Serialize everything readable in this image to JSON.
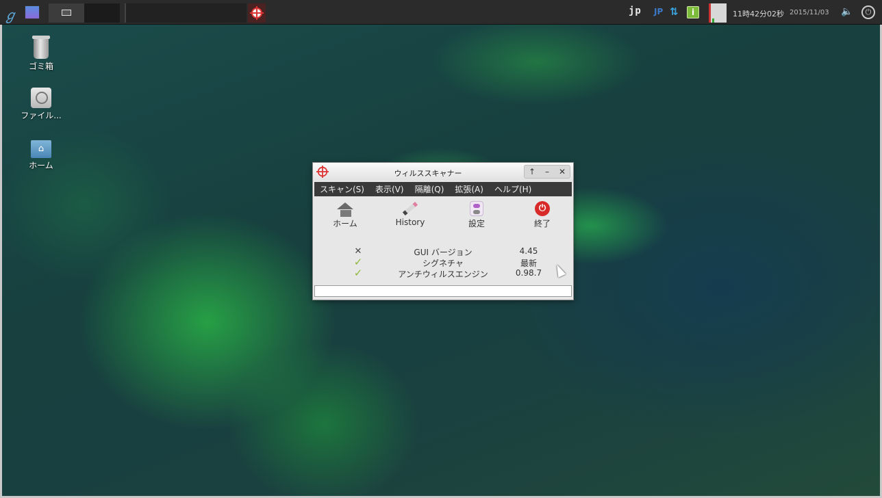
{
  "taskbar": {
    "input_method": "jp",
    "keyboard_layout": "JP",
    "network_icon": "network-updown-icon",
    "info_icon": "i",
    "clock": "11時42分02秒",
    "date": "2015/11/03",
    "power_glyph": "⏻",
    "volume_glyph": "🔈"
  },
  "desktop": {
    "icons": [
      {
        "label": "ゴミ箱",
        "icon": "trash-icon"
      },
      {
        "label": "ファイル...",
        "icon": "drive-icon"
      },
      {
        "label": "ホーム",
        "icon": "home-folder-icon"
      }
    ]
  },
  "window": {
    "title": "ウィルススキャナー",
    "buttons": {
      "up": "↑",
      "minimize": "–",
      "close": "✕"
    },
    "menu": [
      "スキャン(S)",
      "表示(V)",
      "隔離(Q)",
      "拡張(A)",
      "ヘルプ(H)"
    ],
    "toolbar": {
      "home": "ホーム",
      "history": "History",
      "settings": "設定",
      "quit": "終了",
      "quit_glyph": "⏻"
    },
    "status": [
      {
        "mark": "✕",
        "ok": false,
        "name": "GUI バージョン",
        "value": "4.45"
      },
      {
        "mark": "✓",
        "ok": true,
        "name": "シグネチャ",
        "value": "最新"
      },
      {
        "mark": "✓",
        "ok": true,
        "name": "アンチウィルスエンジン",
        "value": "0.98.7"
      }
    ],
    "progress": 0
  },
  "colors": {
    "taskbar_bg": "#2b2b2b",
    "menubar_bg": "#3a3a3a",
    "ok_check": "#8fb83a",
    "quit_red": "#d92a2a"
  }
}
